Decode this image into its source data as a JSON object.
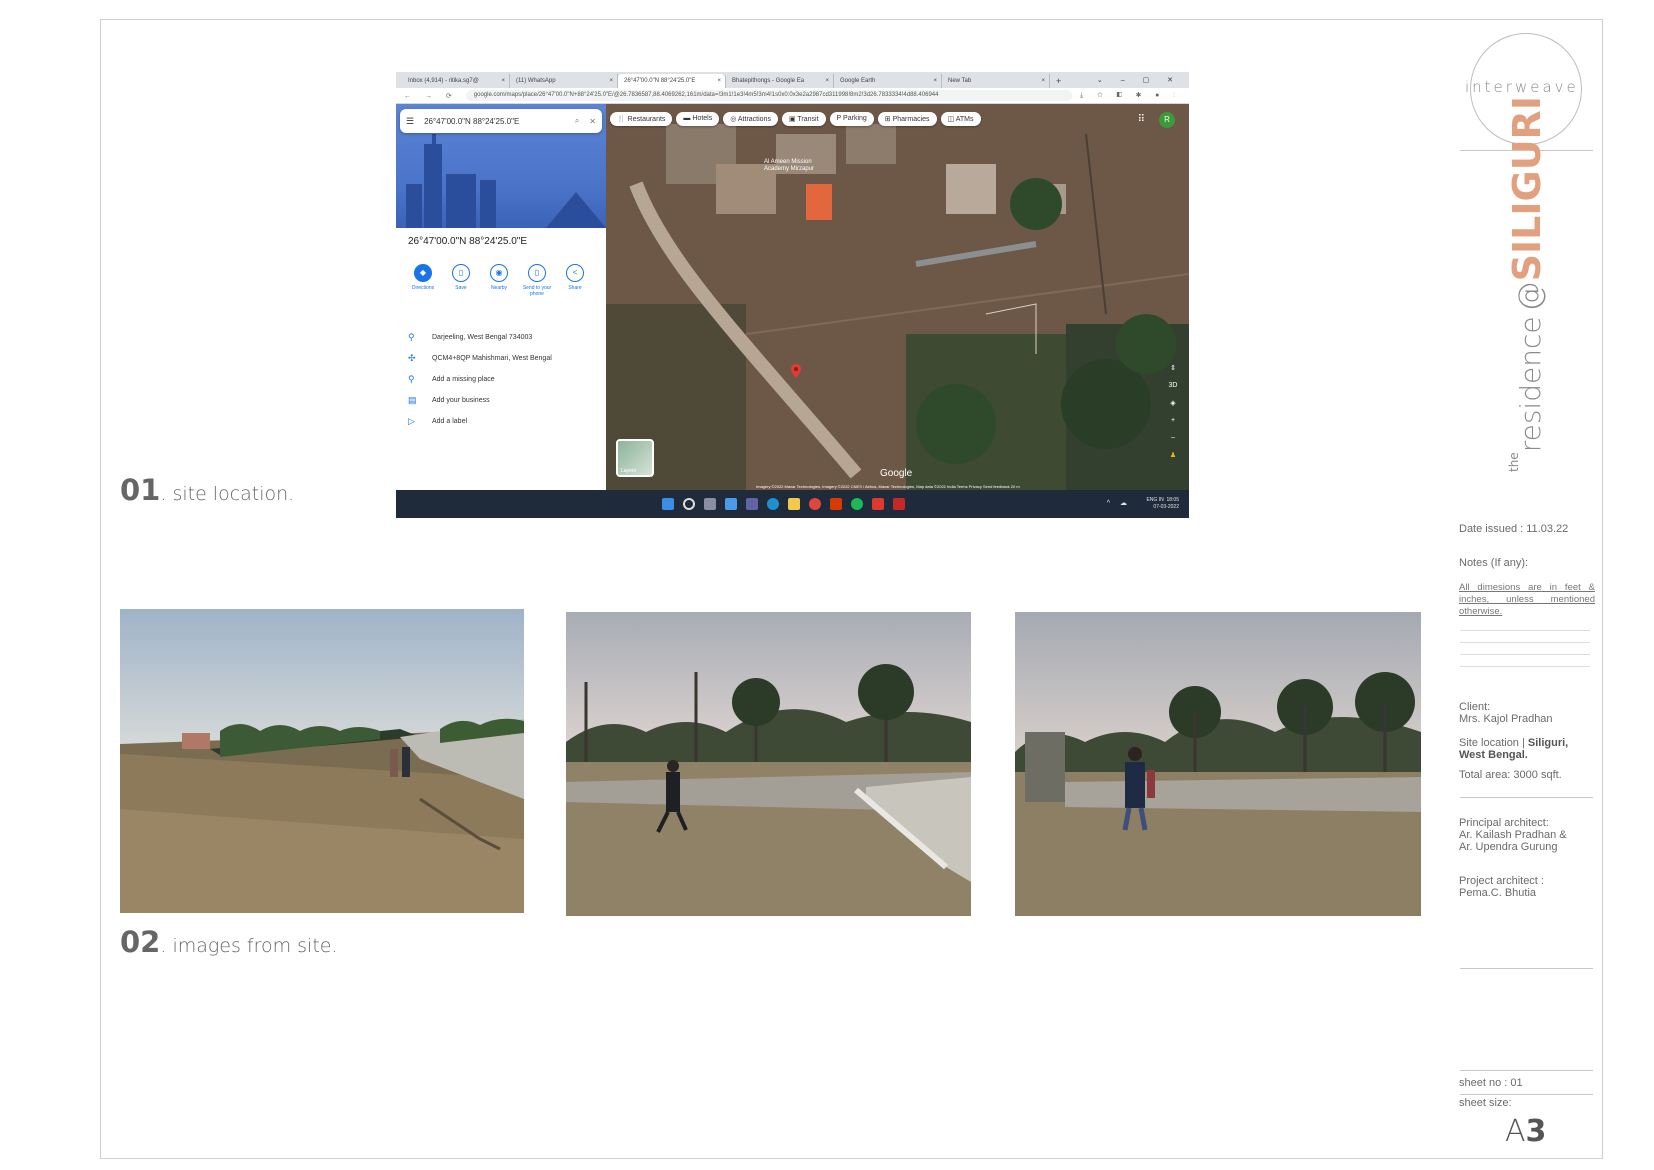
{
  "screenshot": {
    "tabs": [
      {
        "label": "Inbox (4,914) - ritika.sg7@",
        "active": false
      },
      {
        "label": "(11) WhatsApp",
        "active": false
      },
      {
        "label": "26°47'00.0\"N 88°24'25.0\"E",
        "active": true
      },
      {
        "label": "Bhatepithongs - Google Ea",
        "active": false
      },
      {
        "label": "Google Earth",
        "active": false
      },
      {
        "label": "New Tab",
        "active": false
      }
    ],
    "url": "google.com/maps/place/26°47'00.0\"N+88°24'25.0\"E/@26.7836587,88.4069262,161m/data=!3m1!1e3!4m5!3m4!1s0x0:0x3e2a2987cd311998!8m2!3d26.7833334!4d88.406944",
    "search_query": "26°47'00.0\"N 88°24'25.0\"E",
    "place_title": "26°47'00.0\"N 88°24'25.0\"E",
    "actions": [
      {
        "label": "Directions",
        "icon": "directions-icon"
      },
      {
        "label": "Save",
        "icon": "bookmark-icon"
      },
      {
        "label": "Nearby",
        "icon": "nearby-icon"
      },
      {
        "label": "Send to your phone",
        "icon": "phone-icon"
      },
      {
        "label": "Share",
        "icon": "share-icon"
      }
    ],
    "info": [
      {
        "label": "Darjeeling, West Bengal 734003",
        "icon": "location-pin-icon"
      },
      {
        "label": "QCM4+8QP Mahishmari, West Bengal",
        "icon": "plus-code-icon"
      },
      {
        "label": "Add a missing place",
        "icon": "add-place-icon"
      },
      {
        "label": "Add your business",
        "icon": "store-icon"
      },
      {
        "label": "Add a label",
        "icon": "label-icon"
      }
    ],
    "chips": [
      "Restaurants",
      "Hotels",
      "Attractions",
      "Transit",
      "Parking",
      "Pharmacies",
      "ATMs"
    ],
    "map_label": "Al Ameen Mission Academy Mirzapur",
    "google_mark": "Google",
    "layers_label": "Layers",
    "attribution": "Imagery ©2022 Maxar Technologies, Imagery ©2022 CNES / Airbus, Maxar Technologies, Map data ©2022   India   Terms   Privacy   Send feedback   20 m",
    "avatar_letter": "R",
    "tray_lang": "ENG IN",
    "tray_time": "18:05",
    "tray_date": "07-03-2022"
  },
  "captions": {
    "site_location_num": "01",
    "site_location_text": ". site location.",
    "images_num": "02",
    "images_text": ". images from site."
  },
  "title_block": {
    "logo": "interweave",
    "project_the": "the",
    "project_residence": "residence",
    "project_at": "@",
    "project_city": "SILIGURI",
    "date_issued": "Date issued : 11.03.22",
    "notes_label": "Notes (If any):",
    "notes_text": "All dimesions are in feet & inches, unless mentioned otherwise.",
    "client_label": "Client:",
    "client_name": "Mrs. Kajol Pradhan",
    "site_location_label": "Site location |",
    "site_location_value": "Siliguri, West Bengal.",
    "total_area": "Total area: 3000 sqft.",
    "principal_label": "Principal architect:",
    "principal_1": "Ar. Kailash Pradhan &",
    "principal_2": "Ar. Upendra Gurung",
    "project_arch_label": "Project architect :",
    "project_arch_name": "Pema.C. Bhutia",
    "sheet_no": "sheet no  : 01",
    "sheet_size_label": "sheet size:",
    "sheet_size_a": "A",
    "sheet_size_n": "3"
  },
  "colors": {
    "accent_city": "#e3a07e",
    "map_blue": "#1a73e8",
    "taskbar": "#1f2b3a"
  }
}
